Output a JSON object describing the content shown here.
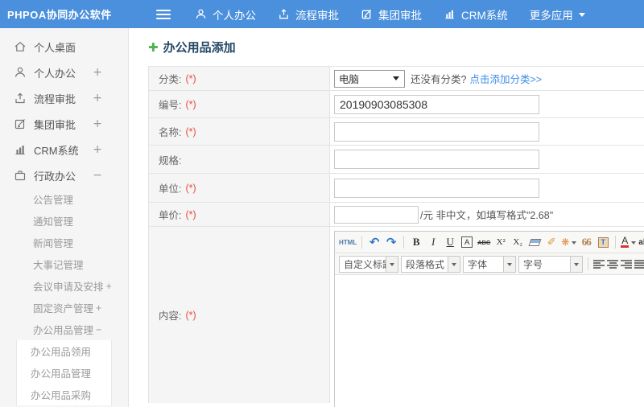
{
  "colors": {
    "topbar_blue": "#4b90dc",
    "link_blue": "#3e8ee8",
    "required_red": "#e74c3c",
    "plus_green": "#52b152",
    "title_navy": "#254867"
  },
  "topbar": {
    "logo": "PHPOA协同办公软件",
    "nav": [
      {
        "label": "个人办公",
        "icon": "user-icon"
      },
      {
        "label": "流程审批",
        "icon": "share-icon"
      },
      {
        "label": "集团审批",
        "icon": "edit-icon"
      },
      {
        "label": "CRM系统",
        "icon": "bar-chart-icon"
      },
      {
        "label": "更多应用",
        "icon": "caret-down-icon"
      }
    ]
  },
  "sidebar": {
    "items": [
      {
        "label": "个人桌面",
        "icon": "home-icon",
        "expander": ""
      },
      {
        "label": "个人办公",
        "icon": "user-icon",
        "expander": "+"
      },
      {
        "label": "流程审批",
        "icon": "share-icon",
        "expander": "+"
      },
      {
        "label": "集团审批",
        "icon": "edit-icon",
        "expander": "+"
      },
      {
        "label": "CRM系统",
        "icon": "bar-chart-icon",
        "expander": "+"
      },
      {
        "label": "行政办公",
        "icon": "briefcase-icon",
        "expander": "−"
      }
    ],
    "admin_children": [
      {
        "label": "公告管理",
        "expander": ""
      },
      {
        "label": "通知管理",
        "expander": ""
      },
      {
        "label": "新闻管理",
        "expander": ""
      },
      {
        "label": "大事记管理",
        "expander": ""
      },
      {
        "label": "会议申请及安排",
        "expander": "+"
      },
      {
        "label": "固定资产管理",
        "expander": "+"
      },
      {
        "label": "办公用品管理",
        "expander": "−"
      }
    ],
    "supplies_children": [
      "办公用品领用",
      "办公用品管理",
      "办公用品采购"
    ]
  },
  "main": {
    "title": "办公用品添加",
    "form": {
      "rows": [
        {
          "label": "分类:",
          "required": "(*)"
        },
        {
          "label": "编号:",
          "required": "(*)",
          "value": "20190903085308"
        },
        {
          "label": "名称:",
          "required": "(*)"
        },
        {
          "label": "规格:",
          "required": ""
        },
        {
          "label": "单位:",
          "required": "(*)"
        },
        {
          "label": "单价:",
          "required": "(*)",
          "suffix": "/元 非中文，如填写格式\"2.68\""
        },
        {
          "label": "内容:",
          "required": "(*)"
        }
      ],
      "category": {
        "select_value": "电脑",
        "hint": "还没有分类?",
        "link": "点击添加分类>>"
      }
    },
    "editor": {
      "glyphs": {
        "html": "HTML",
        "undo": "↶",
        "redo": "↷",
        "bold": "B",
        "italic": "I",
        "underline": "U",
        "border_a": "A",
        "strike": "ABC",
        "sup": "X²",
        "sub": "X₂",
        "brush": "✐",
        "autoformat": "❋",
        "quote": "66",
        "paste": "T",
        "fontcolor": "A",
        "highlight": "ab",
        "highlight_pen": "✐"
      },
      "dropdowns": [
        "自定义标题",
        "段落格式",
        "字体",
        "字号"
      ]
    }
  }
}
